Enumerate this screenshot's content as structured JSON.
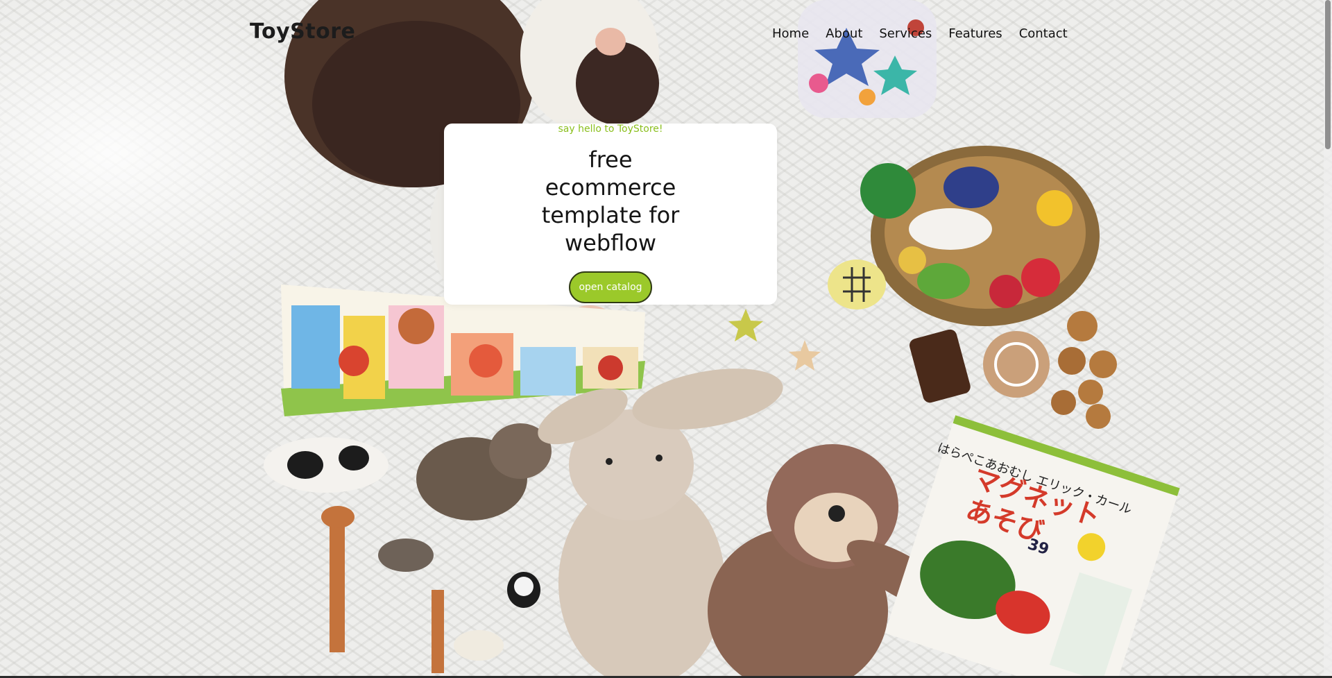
{
  "header": {
    "brand": "ToyStore",
    "nav": [
      "Home",
      "About",
      "Services",
      "Features",
      "Contact"
    ]
  },
  "hero": {
    "tagline": "say hello to ToyStore!",
    "headline": "free ecommerce template for webflow",
    "cta_label": "open catalog"
  },
  "book": {
    "title_line1": "はらぺこあおむし エリック・カール",
    "title_line2": "マグネット",
    "title_line3": "あそび",
    "price_badge": "39"
  },
  "colors": {
    "accent": "#9bc92a",
    "tagline": "#8bbf1e",
    "text": "#151515",
    "card": "#ffffff"
  }
}
